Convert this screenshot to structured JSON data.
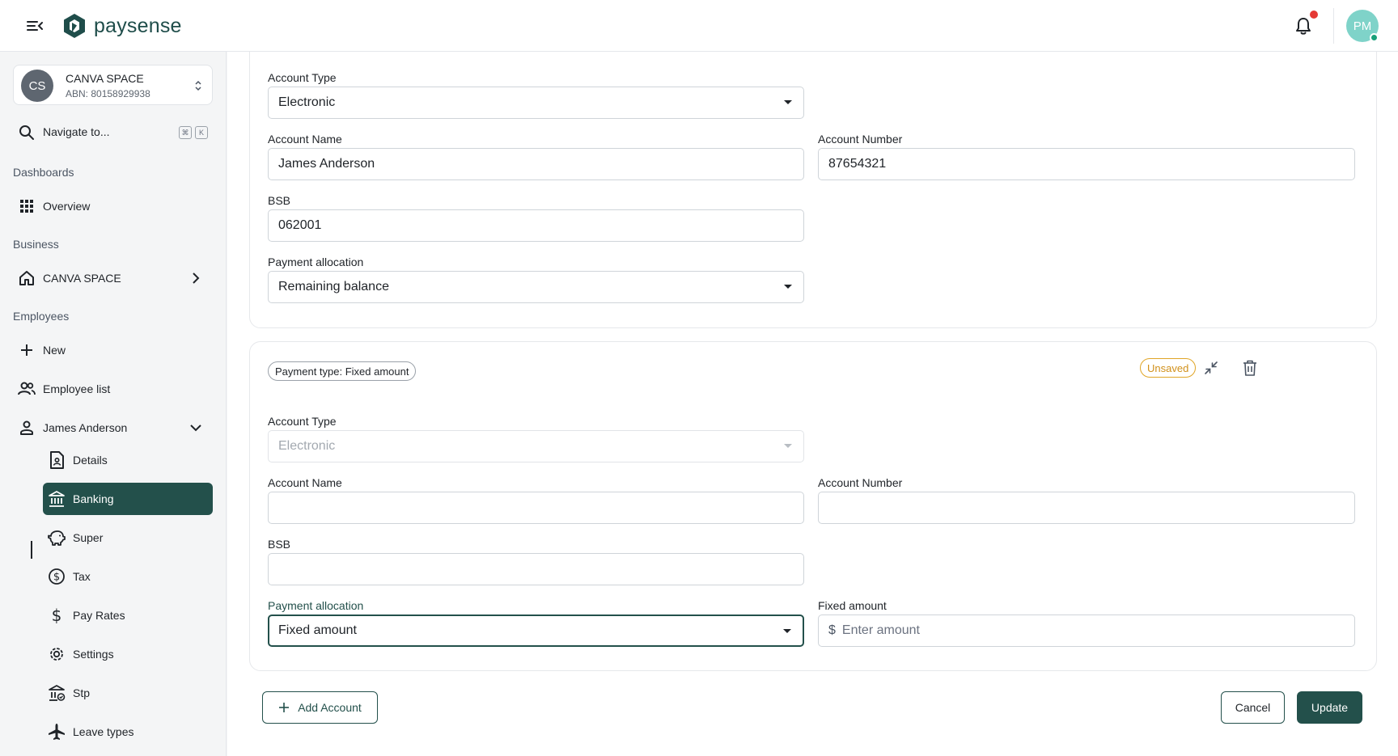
{
  "header": {
    "logo_text": "paysense",
    "avatar_initials": "PM"
  },
  "sidebar": {
    "org": {
      "initials": "CS",
      "name": "CANVA SPACE",
      "abn": "ABN: 80158929938"
    },
    "search": {
      "label": "Navigate to...",
      "kbd1": "⌘",
      "kbd2": "K"
    },
    "sections": {
      "dashboards": "Dashboards",
      "business": "Business",
      "employees": "Employees"
    },
    "items": {
      "overview": "Overview",
      "business_org": "CANVA SPACE",
      "new": "New",
      "employee_list": "Employee list",
      "employee": "James Anderson"
    },
    "sub_items": [
      "Details",
      "Banking",
      "Super",
      "Tax",
      "Pay Rates",
      "Settings",
      "Stp",
      "Leave types"
    ]
  },
  "card1": {
    "account_type_label": "Account Type",
    "account_type_value": "Electronic",
    "account_name_label": "Account Name",
    "account_name_value": "James Anderson",
    "account_number_label": "Account Number",
    "account_number_value": "87654321",
    "bsb_label": "BSB",
    "bsb_value": "062001",
    "allocation_label": "Payment allocation",
    "allocation_value": "Remaining balance"
  },
  "card2": {
    "chip": "Payment type: Fixed amount",
    "status": "Unsaved",
    "account_type_label": "Account Type",
    "account_type_value": "Electronic",
    "account_name_label": "Account Name",
    "account_name_value": "",
    "account_number_label": "Account Number",
    "account_number_value": "",
    "bsb_label": "BSB",
    "bsb_value": "",
    "allocation_label": "Payment allocation",
    "allocation_value": "Fixed amount",
    "fixed_amount_label": "Fixed amount",
    "fixed_amount_prefix": "$",
    "fixed_amount_placeholder": "Enter amount"
  },
  "actions": {
    "add_account": "Add Account",
    "cancel": "Cancel",
    "update": "Update"
  },
  "colors": {
    "brand": "#23504b",
    "warning": "#e0a526",
    "notification": "#e53935",
    "avatar": "#7fd3c9"
  }
}
